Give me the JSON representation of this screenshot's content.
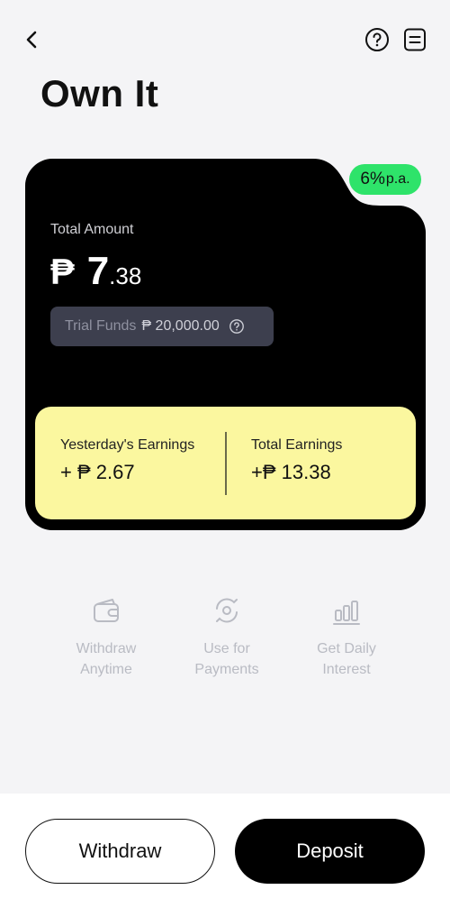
{
  "header": {
    "title": "Own It",
    "icons": {
      "back": "chevron-left-icon",
      "help": "question-circle-icon",
      "doc": "document-icon"
    }
  },
  "card": {
    "rate_value": "6%",
    "rate_suffix": "p.a.",
    "total_label": "Total Amount",
    "currency": "₱",
    "amount_int": "7",
    "amount_dec": ".38",
    "trial_label": "Trial Funds",
    "trial_value": "₱ 20,000.00",
    "yesterday_label": "Yesterday's Earnings",
    "yesterday_value": "+ ₱ 2.67",
    "total_earnings_label": "Total  Earnings",
    "total_earnings_value": "+₱ 13.38",
    "colors": {
      "card": "#000000",
      "badge": "#2ee36a",
      "earnings_panel": "#fbf79f",
      "trial_box": "#3d3f4e"
    }
  },
  "features": [
    {
      "icon": "wallet-icon",
      "line1": "Withdraw",
      "line2": "Anytime"
    },
    {
      "icon": "payment-cycle-icon",
      "line1": "Use for",
      "line2": "Payments"
    },
    {
      "icon": "bar-chart-icon",
      "line1": "Get Daily",
      "line2": "Interest"
    }
  ],
  "actions": {
    "withdraw_label": "Withdraw",
    "deposit_label": "Deposit"
  }
}
